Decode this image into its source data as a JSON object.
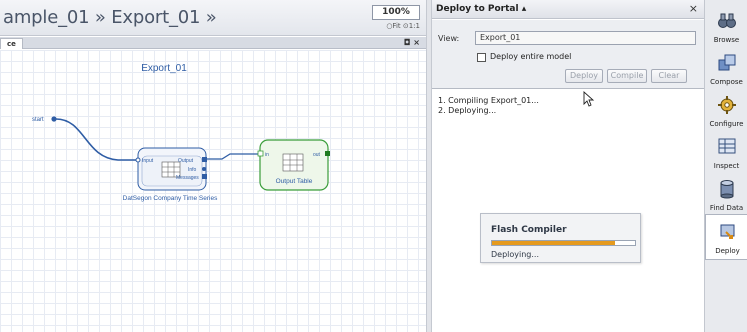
{
  "editor": {
    "breadcrumb": "ample_01 » Export_01 »",
    "zoom_value": "100%",
    "zoom_options": "○Fit ⊙1:1",
    "subtab_label": "ce",
    "subtab_controls": "◘ ×",
    "canvas_title": "Export_01",
    "start_label": "start",
    "source_block": {
      "label": "DatSegon Company Time Series",
      "ports_in": [
        "Input"
      ],
      "ports_out": [
        "Output",
        "Info",
        "Messages"
      ]
    },
    "output_block": {
      "label": "Output Table",
      "port_in": "in",
      "port_out": "out"
    }
  },
  "panel": {
    "title": "Deploy to Portal ▴",
    "close": "×",
    "view_label": "View:",
    "view_value": "Export_01",
    "deploy_entire_model": "Deploy entire model",
    "deploy_entire_model_checked": false,
    "buttons": {
      "deploy": "Deploy",
      "compile": "Compile",
      "clear": "Clear"
    },
    "log": [
      "1. Compiling Export_01...",
      "2. Deploying..."
    ]
  },
  "flash_compiler": {
    "title": "Flash Compiler",
    "status": "Deploying...",
    "progress": 0.86,
    "progress_color": "#e59a1e"
  },
  "toolbar": {
    "items": [
      {
        "label": "Browse",
        "icon": "binoculars-icon"
      },
      {
        "label": "Compose",
        "icon": "compose-icon"
      },
      {
        "label": "Configure",
        "icon": "gear-icon"
      },
      {
        "label": "Inspect",
        "icon": "inspect-icon"
      },
      {
        "label": "Find Data",
        "icon": "database-icon"
      },
      {
        "label": "Deploy",
        "icon": "deploy-icon"
      }
    ],
    "active": "Deploy"
  },
  "colors": {
    "link_blue": "#2f5da5",
    "output_green": "#3a9d3a",
    "grid": "#e7ebf3"
  }
}
